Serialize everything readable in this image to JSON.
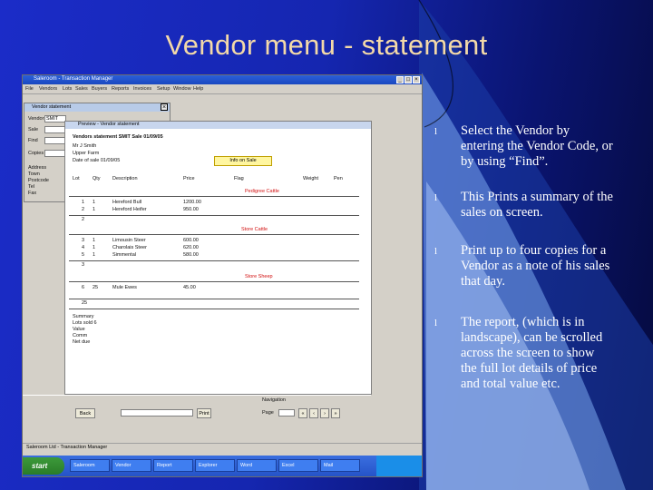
{
  "slide": {
    "title": "Vendor menu - statement",
    "bullets": [
      "Select the Vendor by entering the Vendor Code, or by using “Find”.",
      "This Prints a summary of the sales on screen.",
      "Print up to four copies for a Vendor as a note of his sales that day.",
      "The report, (which is in landscape), can be scrolled across the screen to show the full lot details of price and total value etc."
    ],
    "bullet_glyph": "l"
  },
  "screenshot": {
    "app_title": "Saleroom - Transaction Manager",
    "menu_items": [
      "File",
      "Vendors",
      "Lots",
      "Sales",
      "Buyers",
      "Reports",
      "Invoices",
      "Setup",
      "Window",
      "Help"
    ],
    "vendor_window": {
      "title": "Vendor statement",
      "vendor_label": "Vendor",
      "vendor_value": "SMIT",
      "sale_label": "Sale",
      "find_label": "Find",
      "copies_label": "Copies",
      "side_labels": [
        "Address",
        "Town",
        "Postcode",
        "Tel",
        "Fax"
      ]
    },
    "report": {
      "title": "Preview - Vendor statement",
      "heading": "Vendors statement SMIT Sale 01/09/05",
      "sub_lines": [
        "Mr J Smith",
        "Upper Farm",
        "Date of sale 01/09/05"
      ],
      "highlight": "Info on Sale",
      "columns": [
        "Lot",
        "Qty",
        "Description",
        "Price",
        "Flag",
        "Weight",
        "Pen"
      ],
      "sections": [
        {
          "label": "Pedigree Cattle",
          "rows": [
            [
              "1",
              "1",
              "Hereford Bull",
              "1200.00"
            ],
            [
              "2",
              "1",
              "Hereford Heifer",
              "950.00"
            ]
          ],
          "total": "2"
        },
        {
          "label": "Store Cattle",
          "rows": [
            [
              "3",
              "1",
              "Limousin Steer",
              "600.00"
            ],
            [
              "4",
              "1",
              "Charolais Steer",
              "620.00"
            ],
            [
              "5",
              "1",
              "Simmental",
              "580.00"
            ]
          ],
          "total": "3"
        },
        {
          "label": "Store Sheep",
          "rows": [
            [
              "6",
              "25",
              "Mule Ewes",
              "45.00"
            ]
          ],
          "total": "25"
        }
      ],
      "footer_lines": [
        "Summary",
        "Lots sold 6",
        "Value",
        "Comm",
        "Net due"
      ]
    },
    "bottom_controls": {
      "back_button": "Back",
      "print_button": "Print",
      "page_label": "Page",
      "nav_label": "Navigation"
    },
    "status_text": "Saleroom Ltd - Transaction Manager",
    "taskbar": {
      "start_label": "start",
      "tasks": [
        "Saleroom",
        "Vendor",
        "Report",
        "Explorer",
        "Word",
        "Excel",
        "Mail"
      ]
    }
  }
}
